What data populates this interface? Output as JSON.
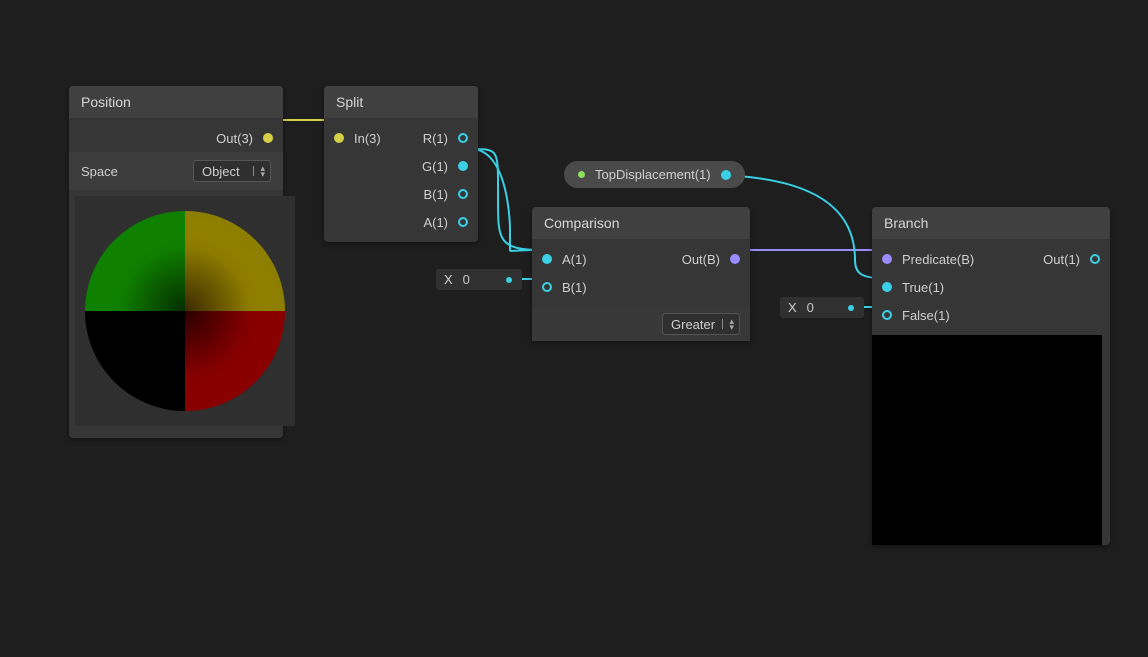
{
  "colors": {
    "edge_yellow": "#d6d047",
    "edge_cyan": "#3ad0e6",
    "edge_purple": "#9a8cff"
  },
  "nodes": {
    "position": {
      "title": "Position",
      "outputs": {
        "out": "Out(3)"
      },
      "params": {
        "space_label": "Space",
        "space_value": "Object"
      }
    },
    "split": {
      "title": "Split",
      "inputs": {
        "in": "In(3)"
      },
      "outputs": {
        "r": "R(1)",
        "g": "G(1)",
        "b": "B(1)",
        "a": "A(1)"
      }
    },
    "comparison": {
      "title": "Comparison",
      "inputs": {
        "a": "A(1)",
        "b": "B(1)"
      },
      "outputs": {
        "out": "Out(B)"
      },
      "b_value": {
        "prefix": "X",
        "value": "0"
      },
      "mode": "Greater"
    },
    "top_displacement": {
      "label": "TopDisplacement(1)"
    },
    "branch": {
      "title": "Branch",
      "inputs": {
        "predicate": "Predicate(B)",
        "true": "True(1)",
        "false": "False(1)"
      },
      "outputs": {
        "out": "Out(1)"
      },
      "false_value": {
        "prefix": "X",
        "value": "0"
      }
    }
  }
}
